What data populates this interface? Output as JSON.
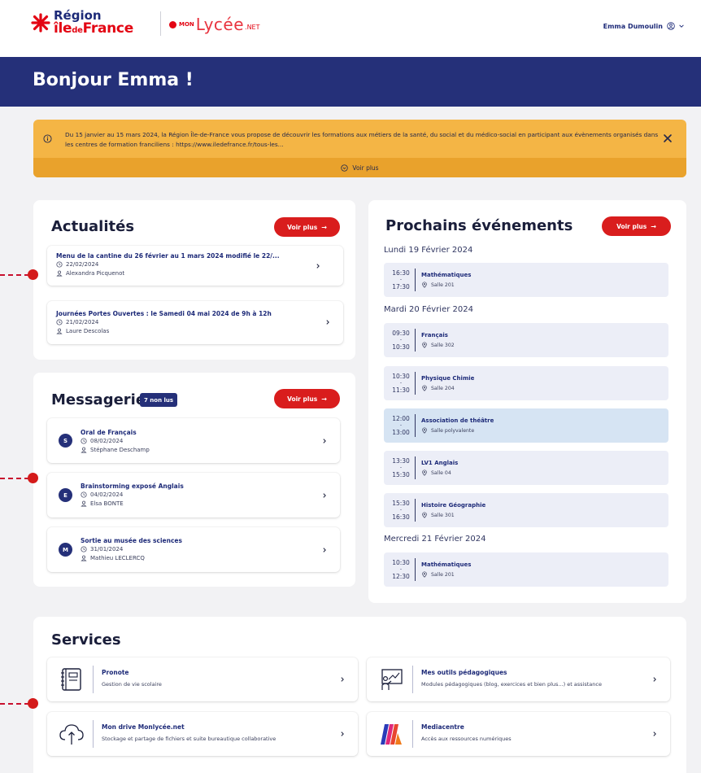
{
  "header": {
    "region_logo_top": "Région",
    "region_logo_bottom_a": "île",
    "region_logo_bottom_b": "de",
    "region_logo_bottom_c": "France",
    "lycee_mon": "MON",
    "lycee_name": "Lycée",
    "lycee_net": ".NET",
    "user_name": "Emma Dumoulin"
  },
  "hero": {
    "greeting": "Bonjour Emma !"
  },
  "alert": {
    "message": "Du 15 janvier au 15 mars 2024, la Région Île-de-France vous propose de découvrir les formations aux métiers de la santé, du social et du médico-social en participant aux évènements organisés dans les centres de formation franciliens : https://www.iledefrance.fr/tous-les...",
    "more_label": "Voir plus"
  },
  "news": {
    "title": "Actualités",
    "more_label": "Voir plus",
    "items": [
      {
        "title": "Menu de la cantine du 26 février au 1 mars 2024 modifié le 22/...",
        "date": "22/02/2024",
        "author": "Alexandra Picquenot"
      },
      {
        "title": "Journées Portes Ouvertes : le Samedi 04 mai 2024 de 9h à 12h",
        "date": "21/02/2024",
        "author": "Laure Descolas"
      }
    ]
  },
  "messages": {
    "title": "Messagerie",
    "unread_badge": "7 non lus",
    "more_label": "Voir plus",
    "items": [
      {
        "initial": "S",
        "title": "Oral de Français",
        "date": "08/02/2024",
        "author": "Stéphane Deschamp"
      },
      {
        "initial": "E",
        "title": "Brainstorming exposé Anglais",
        "date": "04/02/2024",
        "author": "Elsa BONTE"
      },
      {
        "initial": "M",
        "title": "Sortie au musée des sciences",
        "date": "31/01/2024",
        "author": "Mathieu LECLERCQ"
      }
    ]
  },
  "events": {
    "title": "Prochains événements",
    "more_label": "Voir plus",
    "days": [
      {
        "label": "Lundi 19 Février 2024"
      },
      {
        "label": "Mardi 20 Février 2024"
      },
      {
        "label": "Mercredi 21 Février 2024"
      }
    ],
    "items": [
      {
        "start": "16:30",
        "end": "17:30",
        "title": "Mathématiques",
        "room": "Salle 201"
      },
      {
        "start": "09:30",
        "end": "10:30",
        "title": "Français",
        "room": "Salle 302"
      },
      {
        "start": "10:30",
        "end": "11:30",
        "title": "Physique Chimie",
        "room": "Salle 204"
      },
      {
        "start": "12:00",
        "end": "13:00",
        "title": "Association de théâtre",
        "room": "Salle polyvalente"
      },
      {
        "start": "13:30",
        "end": "15:30",
        "title": "LV1 Anglais",
        "room": "Salle 04"
      },
      {
        "start": "15:30",
        "end": "16:30",
        "title": "Histoire Géographie",
        "room": "Salle 301"
      },
      {
        "start": "10:30",
        "end": "12:30",
        "title": "Mathématiques",
        "room": "Salle 201"
      }
    ]
  },
  "services": {
    "title": "Services",
    "items": [
      {
        "title": "Pronote",
        "desc": "Gestion de vie scolaire",
        "icon": "notebook-icon"
      },
      {
        "title": "Mes outils pédagogiques",
        "desc": "Modules pédagogiques (blog, exercices et bien plus...) et assistance",
        "icon": "teacher-board-icon"
      },
      {
        "title": "Mon drive Monlycée.net",
        "desc": "Stockage et partage de fichiers et suite bureautique collaborative",
        "icon": "cloud-icon"
      },
      {
        "title": "Mediacentre",
        "desc": "Accès aux ressources numériques",
        "icon": "mediacentre-logo-icon"
      }
    ]
  },
  "colors": {
    "navy": "#253079",
    "red": "#d91d1d",
    "alert": "#f4b545",
    "event_bg": "#eceef7",
    "event_highlight": "#d6e4f3"
  }
}
